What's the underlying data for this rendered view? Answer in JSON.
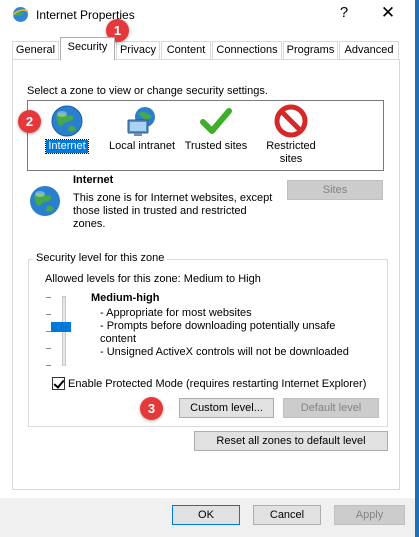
{
  "window": {
    "title": "Internet Properties",
    "help_glyph": "?",
    "close_glyph": "✕"
  },
  "tabs": [
    {
      "label": "General",
      "active": false
    },
    {
      "label": "Security",
      "active": true
    },
    {
      "label": "Privacy",
      "active": false
    },
    {
      "label": "Content",
      "active": false
    },
    {
      "label": "Connections",
      "active": false
    },
    {
      "label": "Programs",
      "active": false
    },
    {
      "label": "Advanced",
      "active": false
    }
  ],
  "security": {
    "zone_prompt": "Select a zone to view or change security settings.",
    "zones": [
      {
        "label": "Internet",
        "icon": "globe-icon",
        "selected": true
      },
      {
        "label": "Local intranet",
        "icon": "intranet-computer-icon",
        "selected": false
      },
      {
        "label": "Trusted sites",
        "icon": "green-check-icon",
        "selected": false
      },
      {
        "label": "Restricted sites",
        "icon": "no-entry-icon",
        "selected": false
      }
    ],
    "selected_zone": {
      "title": "Internet",
      "description": "This zone is for Internet websites, except those listed in trusted and restricted zones.",
      "sites_label": "Sites"
    },
    "level_group": {
      "title": "Security level for this zone",
      "allowed": "Allowed levels for this zone: Medium to High",
      "level_name": "Medium-high",
      "level_bullets": [
        "- Appropriate for most websites",
        "- Prompts before downloading potentially unsafe content",
        "- Unsigned ActiveX controls will not be downloaded"
      ],
      "slider_level": 0.5
    },
    "protected_mode": {
      "label": "Enable Protected Mode (requires restarting Internet Explorer)",
      "checked": true
    },
    "custom_level_label": "Custom level...",
    "default_level_label": "Default level",
    "reset_all_label": "Reset all zones to default level"
  },
  "footer": {
    "ok_label": "OK",
    "cancel_label": "Cancel",
    "apply_label": "Apply"
  },
  "callouts": [
    "1",
    "2",
    "3"
  ],
  "colors": {
    "accent": "#0078d7",
    "callout": "#e5383b",
    "window_border": "#1d6fb8"
  }
}
